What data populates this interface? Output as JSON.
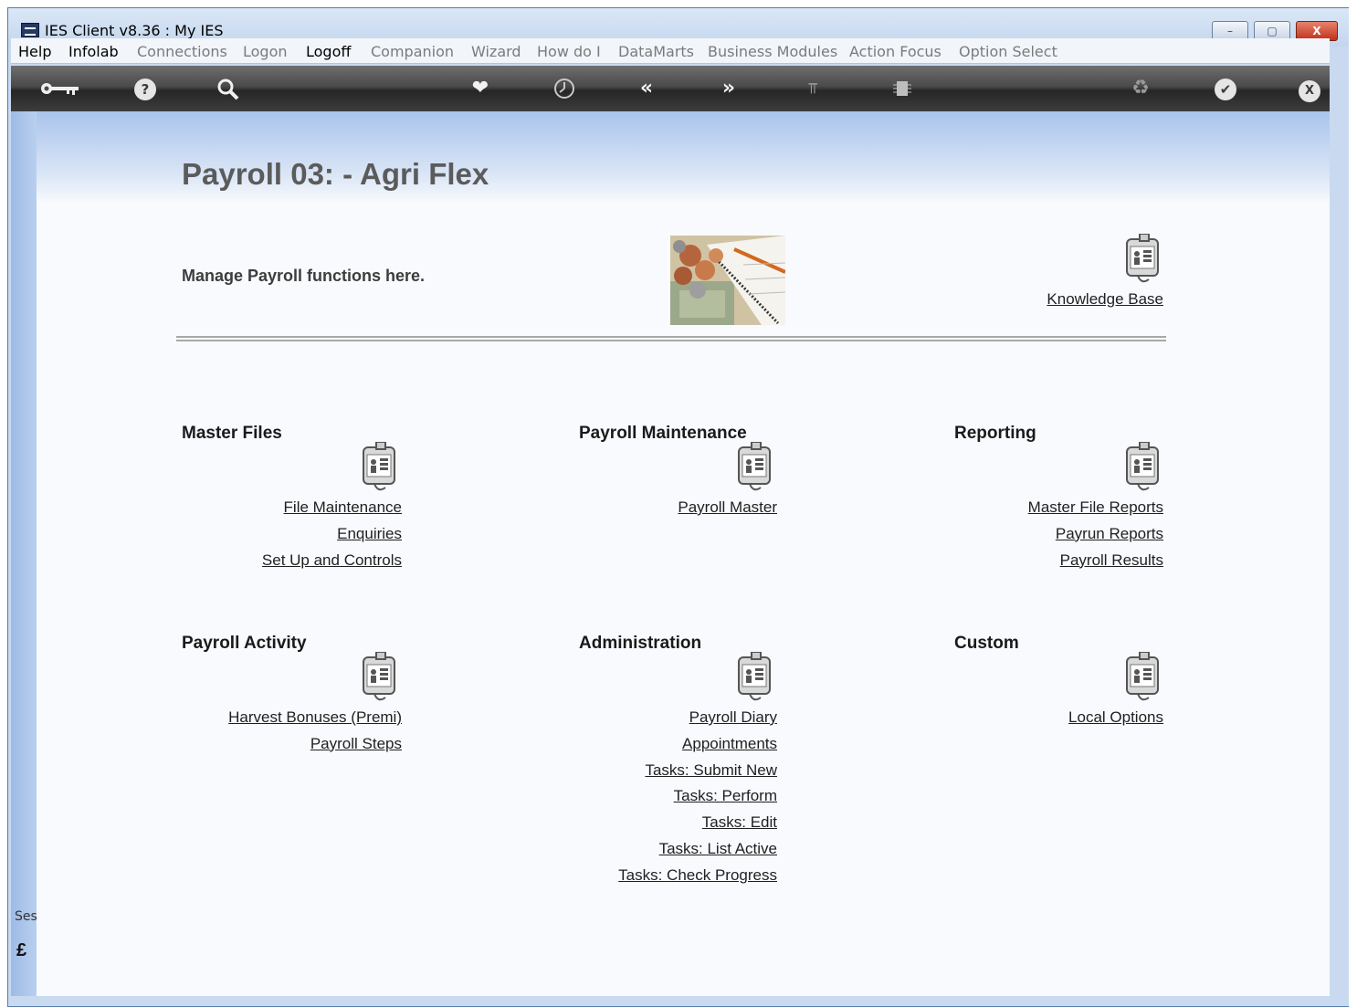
{
  "window": {
    "title": "IES Client v8.36 : My IES",
    "controls": {
      "minimize": "–",
      "maximize": "▢",
      "close": "X"
    }
  },
  "menubar": {
    "items": [
      {
        "label": "Help",
        "active": true
      },
      {
        "label": "Infolab",
        "active": true
      },
      {
        "label": "Connections",
        "active": false
      },
      {
        "label": "Logon",
        "active": false
      },
      {
        "label": "Logoff",
        "active": true
      },
      {
        "label": "Companion",
        "active": false
      },
      {
        "label": "Wizard",
        "active": false
      },
      {
        "label": "How do I",
        "active": false
      },
      {
        "label": "DataMarts",
        "active": false
      },
      {
        "label": "Business Modules",
        "active": false
      },
      {
        "label": "Action Focus",
        "active": false
      },
      {
        "label": "Option Select",
        "active": false
      }
    ]
  },
  "toolbar": {
    "icons": [
      "key-icon",
      "help-icon",
      "search-icon",
      "heart-icon",
      "clock-icon",
      "back-icon",
      "forward-icon",
      "tools-icon",
      "chip-icon",
      "recycle-icon",
      "check-icon",
      "close-icon"
    ]
  },
  "page": {
    "title": "Payroll 03: - Agri Flex",
    "subtitle": "Manage Payroll functions here.",
    "knowledge_base": "Knowledge Base"
  },
  "sections": {
    "master_files": {
      "title": "Master Files",
      "links": [
        "File Maintenance",
        "Enquiries",
        "Set Up and Controls"
      ]
    },
    "payroll_maintenance": {
      "title": "Payroll Maintenance",
      "links": [
        "Payroll Master"
      ]
    },
    "reporting": {
      "title": "Reporting",
      "links": [
        "Master File Reports",
        "Payrun Reports",
        "Payroll Results"
      ]
    },
    "payroll_activity": {
      "title": "Payroll Activity",
      "links": [
        "Harvest Bonuses (Premi)",
        "Payroll Steps"
      ]
    },
    "administration": {
      "title": "Administration",
      "links": [
        "Payroll Diary",
        "Appointments",
        "Tasks: Submit New",
        "Tasks: Perform",
        "Tasks: Edit",
        "Tasks: List Active",
        "Tasks: Check Progress"
      ]
    },
    "custom": {
      "title": "Custom",
      "links": [
        "Local Options"
      ]
    }
  },
  "session": {
    "label": "Ses",
    "glyph": "£"
  },
  "colors": {
    "toolbar_dark": "#262626",
    "panel_blue": "#a9c4ec",
    "title_gray": "#5b5b5b"
  }
}
